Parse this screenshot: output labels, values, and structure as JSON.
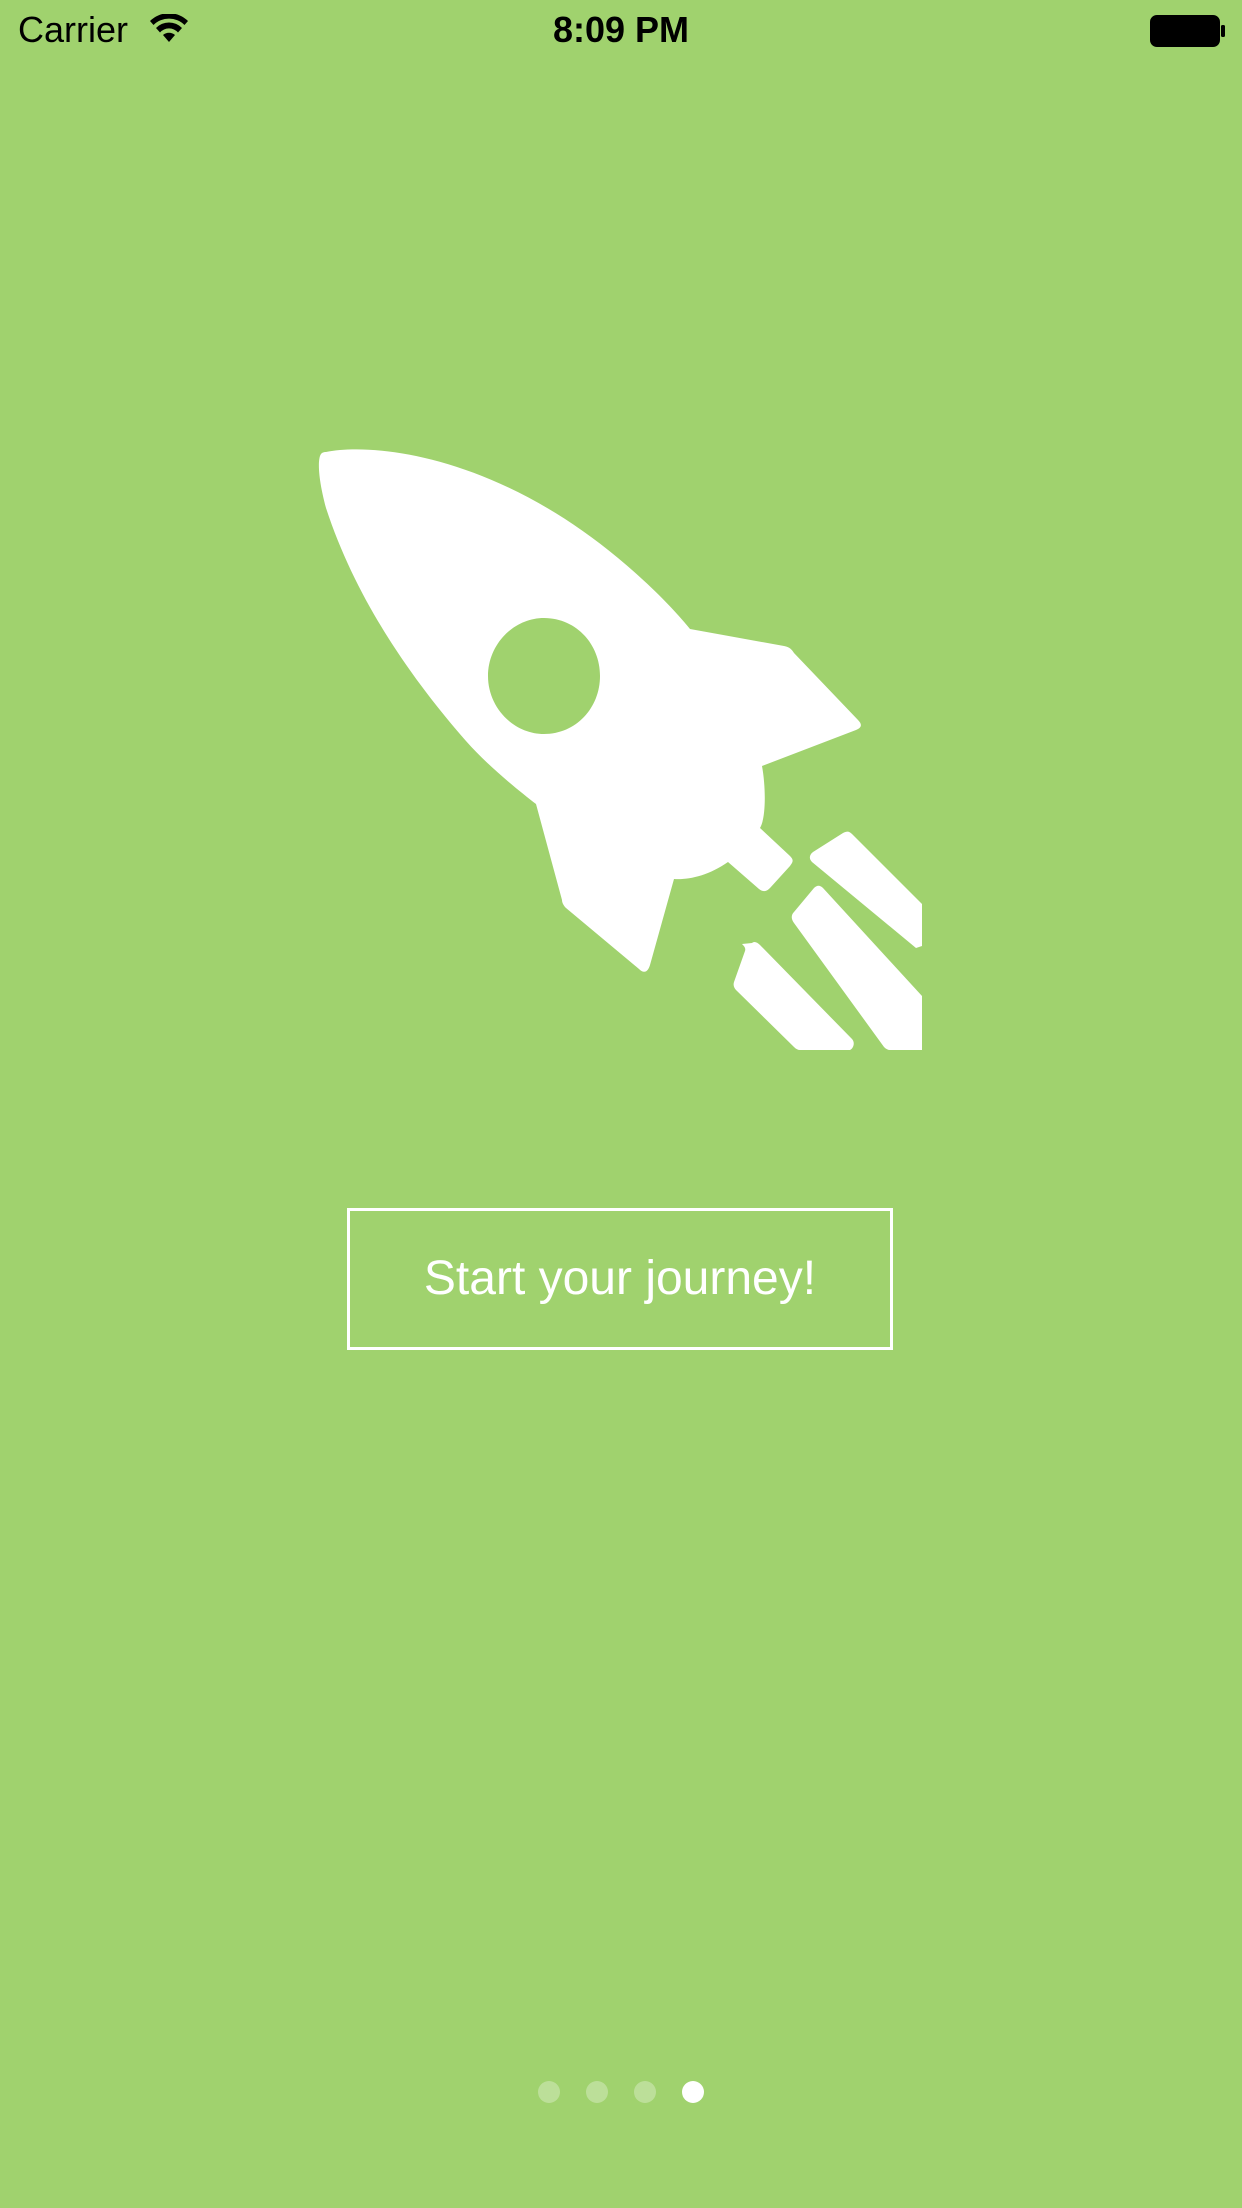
{
  "status_bar": {
    "carrier": "Carrier",
    "time": "8:09 PM",
    "wifi_icon": "wifi-icon",
    "battery_icon": "battery-full-icon"
  },
  "hero": {
    "icon": "rocket-icon",
    "background_color": "#a0d26e",
    "icon_color": "#ffffff"
  },
  "cta": {
    "label": "Start your journey!"
  },
  "pager": {
    "total_pages": 4,
    "current_page": 4
  }
}
